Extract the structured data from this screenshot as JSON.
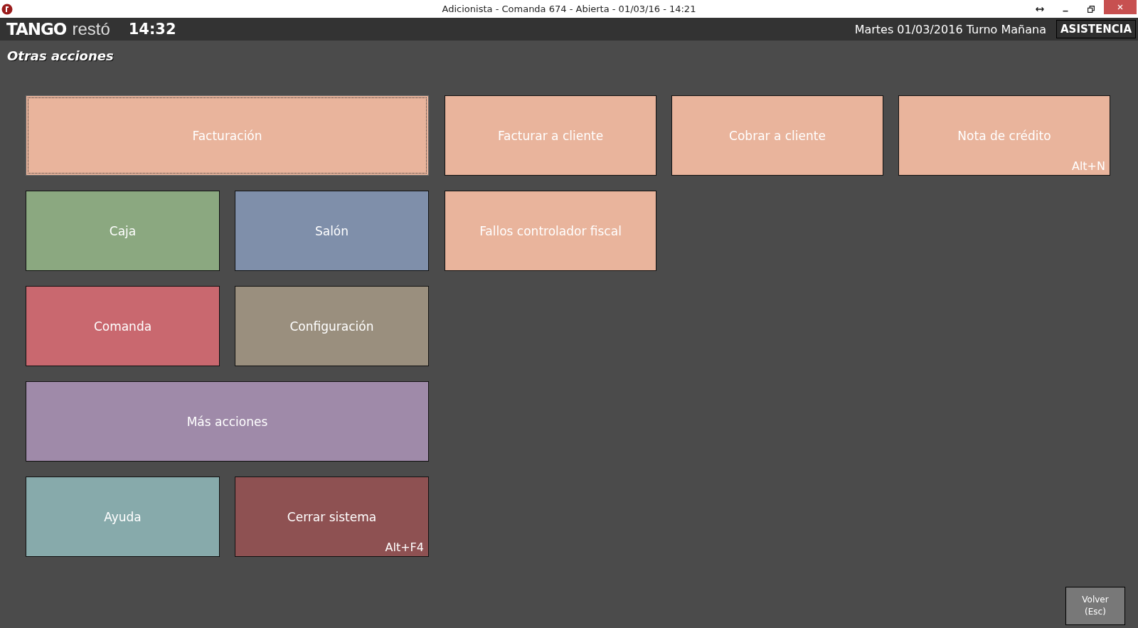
{
  "window": {
    "title": "Adicionista - Comanda 674 - Abierta - 01/03/16 - 14:21"
  },
  "header": {
    "logo_bold": "TANGO",
    "logo_light": "restó",
    "time": "14:32",
    "date_shift": "Martes 01/03/2016 Turno Mañana",
    "assist_button": "ASISTENCIA"
  },
  "section_title": "Otras acciones",
  "menu": [
    {
      "label": "Facturación",
      "color": "#e9b49c",
      "kind": "wide",
      "selected": true
    },
    {
      "label": "Caja",
      "color": "#8ba880",
      "kind": "normal",
      "selected": false
    },
    {
      "label": "Salón",
      "color": "#7f8faa",
      "kind": "normal",
      "selected": false
    },
    {
      "label": "Comanda",
      "color": "#c9686f",
      "kind": "normal",
      "selected": false
    },
    {
      "label": "Configuración",
      "color": "#9a8f7e",
      "kind": "normal",
      "selected": false
    },
    {
      "label": "Más acciones",
      "color": "#9f8aa9",
      "kind": "wide",
      "selected": false
    },
    {
      "label": "Ayuda",
      "color": "#87aaab",
      "kind": "normal",
      "selected": false
    },
    {
      "label": "Cerrar sistema",
      "color": "#8e5152",
      "kind": "normal",
      "selected": false,
      "shortcut": "Alt+F4"
    }
  ],
  "submenu": [
    {
      "label": "Facturar a cliente"
    },
    {
      "label": "Cobrar a cliente"
    },
    {
      "label": "Nota de crédito",
      "shortcut": "Alt+N"
    },
    {
      "label": "Fallos controlador fiscal"
    }
  ],
  "back_button": {
    "line1": "Volver",
    "line2": "(Esc)"
  }
}
